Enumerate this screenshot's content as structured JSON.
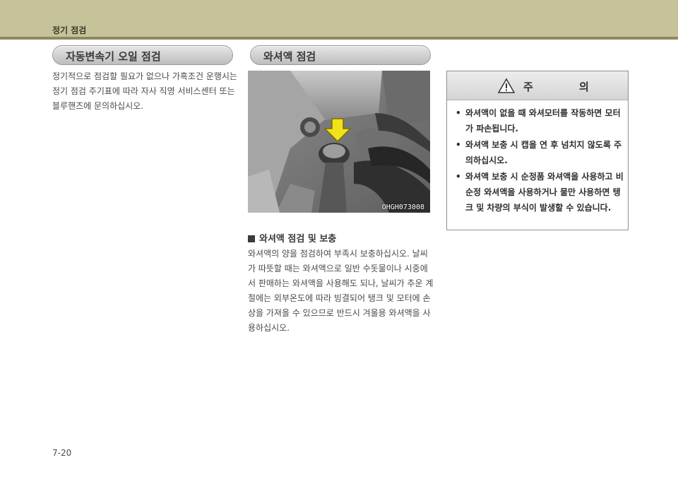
{
  "header": {
    "title": "정기 점검"
  },
  "sections": {
    "transmission": {
      "title": "자동변속기 오일 점검",
      "body": "정기적으로 점검할 필요가 없으나 가혹조건 운행시는 정기 점검 주기표에 따라 자사 직영 서비스센터 또는 블루핸즈에 문의하십시오."
    },
    "washer": {
      "title": "와셔액 점검",
      "photo_code": "OHGH073008",
      "subheading": "와셔액 점검 및 보충",
      "body": "와셔액의 양을 점검하여 부족시 보충하십시오. 날씨가 따뜻할 때는 와셔액으로 일반 수돗물이나 시중에서 판매하는 와셔액을 사용해도 되나, 날씨가 추운 계절에는 외부온도에 따라 빙결되어 탱크 및 모터에 손상을 가져올 수 있으므로 반드시 겨울용 와셔액을 사용하십시오."
    }
  },
  "caution": {
    "title": "주 의",
    "items": [
      "와셔액이 없을 때 와셔모터를 작동하면 모터가 파손됩니다.",
      "와셔액 보충 시 캡을 연 후 넘치지 않도록 주의하십시오.",
      "와셔액 보충 시 순정품 와셔액을 사용하고 비순정 와셔액을 사용하거나 물만 사용하면 탱크 및 차량의 부식이 발생할 수 있습니다."
    ]
  },
  "page_number": "7-20",
  "colors": {
    "header_band": "#c6c39a",
    "header_rule": "#8c8a5e",
    "arrow": "#f2e21a"
  }
}
